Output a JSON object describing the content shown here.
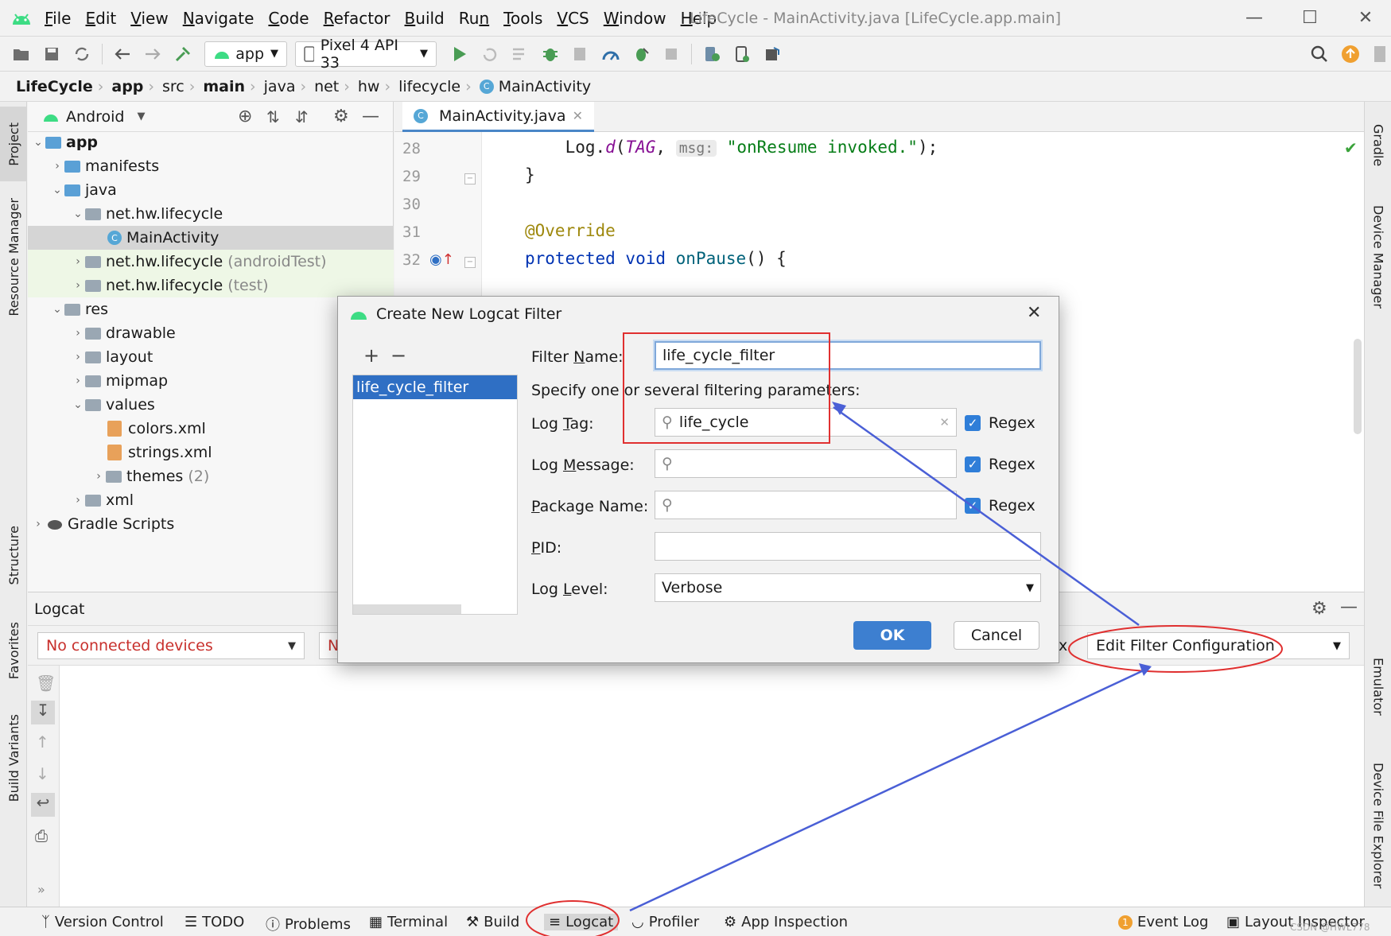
{
  "menubar": {
    "items": [
      {
        "u": "F",
        "rest": "ile"
      },
      {
        "u": "E",
        "rest": "dit"
      },
      {
        "u": "V",
        "rest": "iew"
      },
      {
        "u": "N",
        "rest": "avigate"
      },
      {
        "u": "C",
        "rest": "ode"
      },
      {
        "u": "R",
        "rest": "efactor"
      },
      {
        "u": "B",
        "rest": "uild"
      },
      {
        "u": "R",
        "rest": "u",
        "post": "n"
      },
      {
        "u": "T",
        "rest": "ools"
      },
      {
        "u": "V",
        "rest": "CS"
      },
      {
        "u": "W",
        "rest": "indow"
      },
      {
        "u": "H",
        "rest": "elp"
      }
    ],
    "window_title": "LifeCycle - MainActivity.java [LifeCycle.app.main]"
  },
  "toolbar": {
    "run_config": "app",
    "device": "Pixel 4 API 33"
  },
  "breadcrumb": [
    "LifeCycle",
    "app",
    "src",
    "main",
    "java",
    "net",
    "hw",
    "lifecycle",
    "MainActivity"
  ],
  "left_strip": [
    "Project",
    "Resource Manager",
    "Structure",
    "Favorites",
    "Build Variants"
  ],
  "right_strip": [
    "Gradle",
    "Device Manager",
    "Emulator",
    "Device File Explorer"
  ],
  "project": {
    "view_mode": "Android",
    "tree": {
      "app": "app",
      "manifests": "manifests",
      "java": "java",
      "pkg_main": "net.hw.lifecycle",
      "main_activity": "MainActivity",
      "pkg_android_test": "net.hw.lifecycle",
      "android_test_suffix": "(androidTest)",
      "pkg_test": "net.hw.lifecycle",
      "test_suffix": "(test)",
      "res": "res",
      "drawable": "drawable",
      "layout": "layout",
      "mipmap": "mipmap",
      "values": "values",
      "colors": "colors.xml",
      "strings": "strings.xml",
      "themes": "themes",
      "themes_count": "(2)",
      "xml": "xml",
      "gradle_scripts": "Gradle Scripts"
    }
  },
  "editor": {
    "tab_label": "MainActivity.java",
    "lines": [
      {
        "num": "28",
        "pre": "    Log.",
        "call": "d",
        "open": "(",
        "tag": "TAG",
        "comma": ", ",
        "hint": "msg:",
        "str": "\"onResume invoked.\"",
        "close": ");"
      },
      {
        "num": "29",
        "text": "}"
      },
      {
        "num": "30",
        "text": ""
      },
      {
        "num": "31",
        "text": "@Override"
      },
      {
        "num": "32",
        "kw": "protected void ",
        "fn": "onPause",
        "rest": "() {"
      }
    ]
  },
  "logcat": {
    "title": "Logcat",
    "device_select": "No connected devices",
    "process_select_partial": "N",
    "regex_partial": "x",
    "filter_select": "Edit Filter Configuration"
  },
  "dialog": {
    "title": "Create New Logcat Filter",
    "filter_list": [
      "life_cycle_filter"
    ],
    "filter_name_label": {
      "pre": "Filter ",
      "u": "N",
      "post": "ame:"
    },
    "filter_name_value": "life_cycle_filter",
    "params_label": "Specify one or several filtering parameters:",
    "log_tag_label": {
      "pre": "Log ",
      "u": "T",
      "post": "ag:"
    },
    "log_tag_value": "life_cycle",
    "log_message_label": {
      "pre": "Log ",
      "u": "M",
      "post": "essage:"
    },
    "package_name_label": {
      "pre": "",
      "u": "P",
      "post": "ackage Name:"
    },
    "pid_label": {
      "pre": "",
      "u": "P",
      "post": "ID:"
    },
    "log_level_label": {
      "pre": "Log ",
      "u": "L",
      "post": "evel:"
    },
    "log_level_value": "Verbose",
    "regex_label": "Regex",
    "ok_label": "OK",
    "cancel_label": "Cancel"
  },
  "statusbar": {
    "items": [
      "Version Control",
      "TODO",
      "Problems",
      "Terminal",
      "Build",
      "Logcat",
      "Profiler",
      "App Inspection"
    ],
    "right": [
      "Event Log",
      "Layout Inspector"
    ],
    "event_log_count": "1",
    "watermark": "CSDN @HWL778"
  },
  "colors": {
    "annotation_red": "#e03030",
    "arrow_blue": "#4a5fd6",
    "selection_blue": "#2f6fc4"
  }
}
